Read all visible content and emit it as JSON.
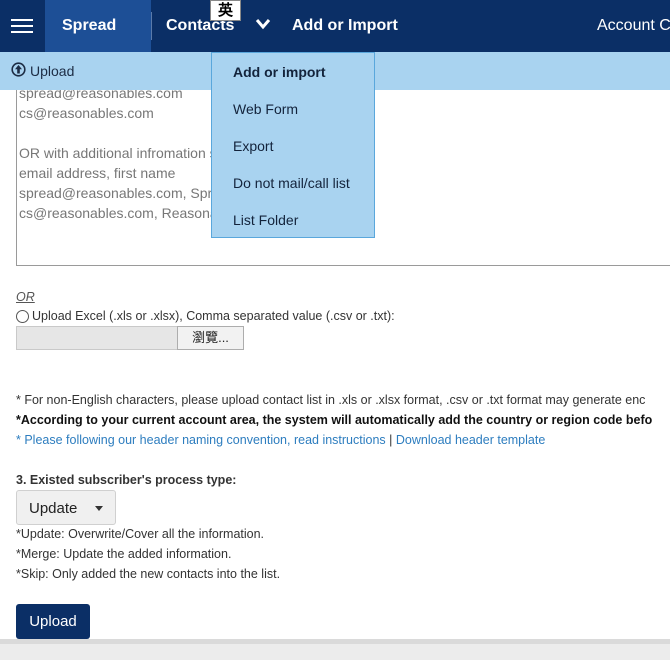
{
  "topnav": {
    "brand": "Spread",
    "contacts": "Contacts",
    "add_or_import": "Add or Import",
    "account": "Account C",
    "ime_indicator": "英",
    "menu_icon": "hamburger-icon",
    "chevron_icon": "chevron-down-icon"
  },
  "subbar": {
    "label": "Upload",
    "icon": "upload-circle-icon"
  },
  "dropdown": {
    "items": [
      {
        "label": "Add or import",
        "active": true
      },
      {
        "label": "Web Form"
      },
      {
        "label": "Export"
      },
      {
        "label": "Do not mail/call list"
      },
      {
        "label": "List Folder"
      }
    ]
  },
  "textarea": {
    "lines": [
      "spread@reasonables.com",
      "cs@reasonables.com",
      "",
      "OR with additional infromation s",
      "email address, first name",
      "spread@reasonables.com, Spr",
      "cs@reasonables.com, Reasona"
    ]
  },
  "upload_file": {
    "or_label": "OR",
    "option_label": "Upload Excel (.xls or .xlsx), Comma separated value (.csv or .txt):",
    "browse_label": "瀏覽..."
  },
  "notes": {
    "non_english": "* For non-English characters, please upload contact list in .xls or .xlsx format, .csv or .txt format may generate enc",
    "country_code": "*According to your current account area, the system will automatically add the country or region code befo",
    "naming_link": "* Please following our header naming convention, read instructions",
    "separator": "|",
    "download_link": "Download header template"
  },
  "process": {
    "title": "3. Existed subscriber's process type:",
    "selected": "Update",
    "descriptions": [
      "*Update: Overwrite/Cover all the information.",
      "*Merge: Update the added information.",
      "*Skip: Only added the new contacts into the list."
    ]
  },
  "actions": {
    "upload_label": "Upload"
  },
  "colors": {
    "nav_bg": "#0b2f66",
    "brand_bg": "#1d4f96",
    "subbar_bg": "#a9d3f0",
    "link": "#2d7dbf"
  }
}
